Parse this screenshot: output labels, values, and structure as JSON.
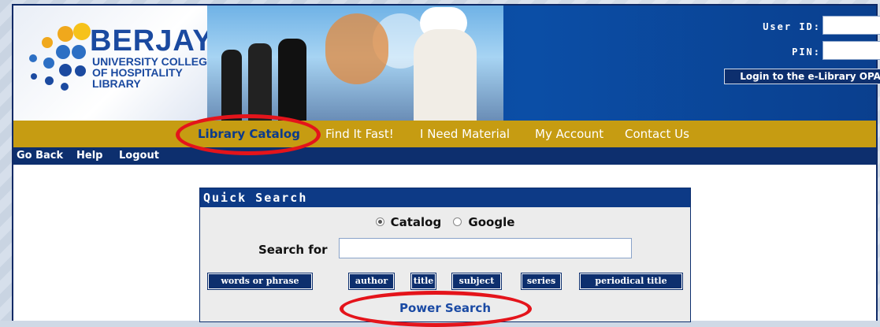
{
  "brand": {
    "name": "BERJAYA",
    "subtitle_line1": "UNIVERSITY COLLEGE",
    "subtitle_line2": "OF HOSPITALITY",
    "subtitle_line3": "LIBRARY"
  },
  "login": {
    "user_id_label": "User ID:",
    "pin_label": "PIN:",
    "user_id_value": "",
    "pin_value": "",
    "button_label": "Login to the e-Library OPAC"
  },
  "nav": {
    "items": [
      {
        "label": "Library Catalog",
        "active": true
      },
      {
        "label": "Find It Fast!",
        "active": false
      },
      {
        "label": "I Need Material",
        "active": false
      },
      {
        "label": "My Account",
        "active": false
      },
      {
        "label": "Contact Us",
        "active": false
      }
    ]
  },
  "util": {
    "items": [
      "Go Back",
      "Help",
      "Logout"
    ]
  },
  "quick_search": {
    "title": "Quick Search",
    "radio_options": [
      {
        "label": "Catalog",
        "selected": true
      },
      {
        "label": "Google",
        "selected": false
      }
    ],
    "search_label": "Search for",
    "search_value": "",
    "buttons": [
      "words or phrase",
      "author",
      "title",
      "subject",
      "series",
      "periodical title"
    ],
    "power_search": "Power Search"
  },
  "colors": {
    "header_blue": "#0b4ea6",
    "nav_gold": "#c69c12",
    "util_navy": "#0d2f6e",
    "annotation_red": "#e4141b"
  }
}
